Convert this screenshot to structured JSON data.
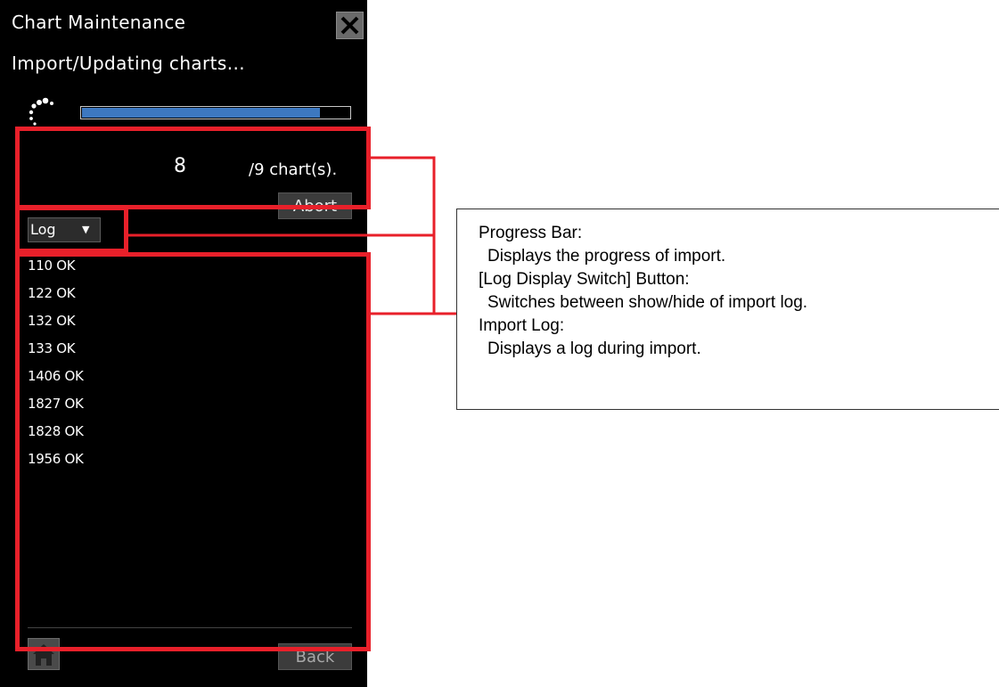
{
  "dialog": {
    "title": "Chart Maintenance",
    "status": "Import/Updating charts...",
    "progress": {
      "fraction": 0.89
    },
    "count_current": "8",
    "count_total": "/9 chart(s).",
    "abort_label": "Abort",
    "log_dropdown": {
      "selected": "Log"
    },
    "log_entries": [
      "110 OK",
      "122 OK",
      "132 OK",
      "133 OK",
      "1406 OK",
      "1827 OK",
      "1828 OK",
      "1956 OK"
    ],
    "back_label": "Back"
  },
  "callout": {
    "items": [
      {
        "title": "Progress Bar:",
        "description": "Displays the progress of import."
      },
      {
        "title": "[Log Display Switch] Button:",
        "description": "Switches between show/hide of import log."
      },
      {
        "title": "Import Log:",
        "description": "Displays a log during import."
      }
    ]
  },
  "colors": {
    "panel_background": "#000000",
    "progress_fill": "#3d78c0",
    "highlight_red": "#e8202a",
    "button_grey": "#3c3c3c"
  },
  "icons": [
    "close-icon",
    "spinner-icon",
    "dropdown-arrow-icon",
    "home-icon"
  ]
}
